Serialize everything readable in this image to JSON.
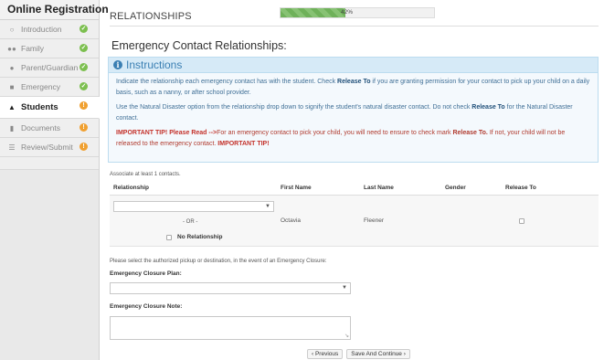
{
  "sidebar": {
    "title": "Online Registration",
    "items": [
      {
        "label": "Introduction",
        "status": "done"
      },
      {
        "label": "Family",
        "status": "done"
      },
      {
        "label": "Parent/Guardian",
        "status": "done"
      },
      {
        "label": "Emergency",
        "status": "done"
      },
      {
        "label": "Students",
        "status": "warning"
      },
      {
        "label": "Documents",
        "status": "warning"
      },
      {
        "label": "Review/Submit",
        "status": "warning"
      }
    ],
    "status_colors": {
      "done": "#7cbf4f",
      "warning": "#f0a030"
    }
  },
  "header": {
    "section_title": "RELATIONSHIPS",
    "progress_percent": 42,
    "progress_label": "42%"
  },
  "page_title": "Emergency Contact Relationships:",
  "instructions": {
    "heading": "Instructions",
    "p1_a": "Indicate the relationship each emergency contact has with the student. Check ",
    "p1_b": "Release To",
    "p1_c": " if you are granting permission for your contact to pick up your child on a daily basis, such as a nanny, or after school provider.",
    "p2_a": "Use the Natural Disaster option from the relationship drop down to signify the student's natural disaster contact. Do not check ",
    "p2_b": "Release To",
    "p2_c": " for the Natural Disaster contact.",
    "p3_a": "IMPORTANT TIP! Please Read -->",
    "p3_b": "For an emergency contact to pick your child, you will need to ensure to check mark ",
    "p3_c": "Release To.",
    "p3_d": " If not, your child will not be released to the emergency contact. ",
    "p3_e": "IMPORTANT TIP!"
  },
  "contacts": {
    "associate_text": "Associate at least 1 contacts.",
    "columns": [
      "Relationship",
      "First Name",
      "Last Name",
      "Gender",
      "Release To"
    ],
    "rows": [
      {
        "relationship": "",
        "first_name": "Octavia",
        "last_name": "Fleener",
        "gender": "",
        "release_to": false
      }
    ],
    "or_text": "- OR -",
    "no_relationship_label": "No Relationship"
  },
  "closure": {
    "question": "Please select the authorized pickup or destination, in the event of an Emergency Closure:",
    "plan_label": "Emergency Closure Plan:",
    "plan_value": "",
    "note_label": "Emergency Closure Note:",
    "note_value": ""
  },
  "buttons": {
    "previous": "‹ Previous",
    "save_continue": "Save And Continue ›"
  }
}
